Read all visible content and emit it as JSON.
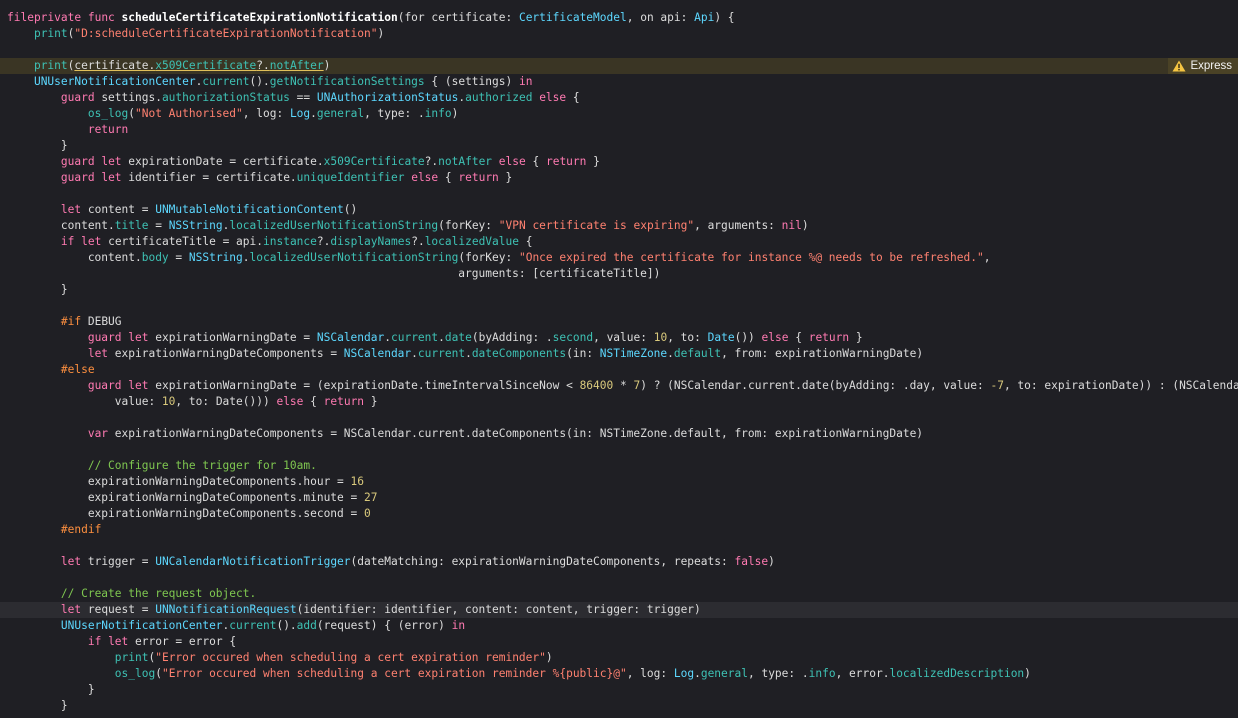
{
  "colors": {
    "background": "#1f1f24",
    "keyword": "#ff7ab2",
    "string": "#ff8170",
    "type": "#5dd8ff",
    "function": "#3ec1b4",
    "number": "#d9c97c",
    "comment": "#7fc750",
    "preprocessor": "#fd8f3f",
    "warning_line": "#3a3524",
    "warning_badge": "#4a4226"
  },
  "editor": {
    "issue_badge": {
      "icon": "warning-triangle-icon",
      "label": "Express"
    },
    "lines": [
      {
        "t": [
          [
            "kw",
            "fileprivate"
          ],
          [
            "p",
            " "
          ],
          [
            "kw",
            "func"
          ],
          [
            "p",
            " "
          ],
          [
            "b",
            "scheduleCertificateExpirationNotification"
          ],
          [
            "p",
            "(for certificate: "
          ],
          [
            "ty",
            "CertificateModel"
          ],
          [
            "p",
            ", on api: "
          ],
          [
            "ty",
            "Api"
          ],
          [
            "p",
            ") {"
          ]
        ]
      },
      {
        "t": [
          [
            "p",
            "    "
          ],
          [
            "fn",
            "print"
          ],
          [
            "p",
            "("
          ],
          [
            "s",
            "\"D:scheduleCertificateExpirationNotification\""
          ],
          [
            "p",
            ")"
          ]
        ]
      },
      {
        "t": []
      },
      {
        "hl": "warn",
        "t": [
          [
            "p",
            "    "
          ],
          [
            "fn",
            "print"
          ],
          [
            "p",
            "("
          ],
          [
            "ul",
            "certificate."
          ],
          [
            "prul",
            "x509Certificate"
          ],
          [
            "ul",
            "?."
          ],
          [
            "prul",
            "notAfter"
          ],
          [
            "p",
            ")"
          ]
        ]
      },
      {
        "t": [
          [
            "p",
            "    "
          ],
          [
            "ty",
            "UNUserNotificationCenter"
          ],
          [
            "p",
            "."
          ],
          [
            "fn",
            "current"
          ],
          [
            "p",
            "()."
          ],
          [
            "fn",
            "getNotificationSettings"
          ],
          [
            "p",
            " { (settings) "
          ],
          [
            "kw",
            "in"
          ]
        ]
      },
      {
        "t": [
          [
            "p",
            "        "
          ],
          [
            "kw",
            "guard"
          ],
          [
            "p",
            " settings."
          ],
          [
            "pr",
            "authorizationStatus"
          ],
          [
            "p",
            " == "
          ],
          [
            "ty",
            "UNAuthorizationStatus"
          ],
          [
            "p",
            "."
          ],
          [
            "pr",
            "authorized"
          ],
          [
            "p",
            " "
          ],
          [
            "kw",
            "else"
          ],
          [
            "p",
            " {"
          ]
        ]
      },
      {
        "t": [
          [
            "p",
            "            "
          ],
          [
            "fn",
            "os_log"
          ],
          [
            "p",
            "("
          ],
          [
            "s",
            "\"Not Authorised\""
          ],
          [
            "p",
            ", log: "
          ],
          [
            "ty",
            "Log"
          ],
          [
            "p",
            "."
          ],
          [
            "pr",
            "general"
          ],
          [
            "p",
            ", type: ."
          ],
          [
            "pr",
            "info"
          ],
          [
            "p",
            ")"
          ]
        ]
      },
      {
        "t": [
          [
            "p",
            "            "
          ],
          [
            "kw",
            "return"
          ]
        ]
      },
      {
        "t": [
          [
            "p",
            "        }"
          ]
        ]
      },
      {
        "t": [
          [
            "p",
            "        "
          ],
          [
            "kw",
            "guard"
          ],
          [
            "p",
            " "
          ],
          [
            "kw",
            "let"
          ],
          [
            "p",
            " expirationDate = certificate."
          ],
          [
            "pr",
            "x509Certificate"
          ],
          [
            "p",
            "?."
          ],
          [
            "pr",
            "notAfter"
          ],
          [
            "p",
            " "
          ],
          [
            "kw",
            "else"
          ],
          [
            "p",
            " { "
          ],
          [
            "kw",
            "return"
          ],
          [
            "p",
            " }"
          ]
        ]
      },
      {
        "t": [
          [
            "p",
            "        "
          ],
          [
            "kw",
            "guard"
          ],
          [
            "p",
            " "
          ],
          [
            "kw",
            "let"
          ],
          [
            "p",
            " identifier = certificate."
          ],
          [
            "pr",
            "uniqueIdentifier"
          ],
          [
            "p",
            " "
          ],
          [
            "kw",
            "else"
          ],
          [
            "p",
            " { "
          ],
          [
            "kw",
            "return"
          ],
          [
            "p",
            " }"
          ]
        ]
      },
      {
        "t": []
      },
      {
        "t": [
          [
            "p",
            "        "
          ],
          [
            "kw",
            "let"
          ],
          [
            "p",
            " content = "
          ],
          [
            "ty",
            "UNMutableNotificationContent"
          ],
          [
            "p",
            "()"
          ]
        ]
      },
      {
        "t": [
          [
            "p",
            "        content."
          ],
          [
            "pr",
            "title"
          ],
          [
            "p",
            " = "
          ],
          [
            "ty",
            "NSString"
          ],
          [
            "p",
            "."
          ],
          [
            "fn",
            "localizedUserNotificationString"
          ],
          [
            "p",
            "(forKey: "
          ],
          [
            "s",
            "\"VPN certificate is expiring\""
          ],
          [
            "p",
            ", arguments: "
          ],
          [
            "kw",
            "nil"
          ],
          [
            "p",
            ")"
          ]
        ]
      },
      {
        "t": [
          [
            "p",
            "        "
          ],
          [
            "kw",
            "if"
          ],
          [
            "p",
            " "
          ],
          [
            "kw",
            "let"
          ],
          [
            "p",
            " certificateTitle = api."
          ],
          [
            "pr",
            "instance"
          ],
          [
            "p",
            "?."
          ],
          [
            "pr",
            "displayNames"
          ],
          [
            "p",
            "?."
          ],
          [
            "pr",
            "localizedValue"
          ],
          [
            "p",
            " {"
          ]
        ]
      },
      {
        "t": [
          [
            "p",
            "            content."
          ],
          [
            "pr",
            "body"
          ],
          [
            "p",
            " = "
          ],
          [
            "ty",
            "NSString"
          ],
          [
            "p",
            "."
          ],
          [
            "fn",
            "localizedUserNotificationString"
          ],
          [
            "p",
            "(forKey: "
          ],
          [
            "s",
            "\"Once expired the certificate for instance %@ needs to be refreshed.\""
          ],
          [
            "p",
            ","
          ]
        ]
      },
      {
        "t": [
          [
            "p",
            "                                                                   arguments: [certificateTitle])"
          ]
        ]
      },
      {
        "t": [
          [
            "p",
            "        }"
          ]
        ]
      },
      {
        "t": []
      },
      {
        "t": [
          [
            "p",
            "        "
          ],
          [
            "pp",
            "#if"
          ],
          [
            "p",
            " DEBUG"
          ]
        ]
      },
      {
        "t": [
          [
            "p",
            "            "
          ],
          [
            "kw",
            "guard"
          ],
          [
            "p",
            " "
          ],
          [
            "kw",
            "let"
          ],
          [
            "p",
            " expirationWarningDate = "
          ],
          [
            "ty",
            "NSCalendar"
          ],
          [
            "p",
            "."
          ],
          [
            "pr",
            "current"
          ],
          [
            "p",
            "."
          ],
          [
            "fn",
            "date"
          ],
          [
            "p",
            "(byAdding: ."
          ],
          [
            "pr",
            "second"
          ],
          [
            "p",
            ", value: "
          ],
          [
            "n",
            "10"
          ],
          [
            "p",
            ", to: "
          ],
          [
            "ty",
            "Date"
          ],
          [
            "p",
            "()) "
          ],
          [
            "kw",
            "else"
          ],
          [
            "p",
            " { "
          ],
          [
            "kw",
            "return"
          ],
          [
            "p",
            " }"
          ]
        ]
      },
      {
        "t": [
          [
            "p",
            "            "
          ],
          [
            "kw",
            "let"
          ],
          [
            "p",
            " expirationWarningDateComponents = "
          ],
          [
            "ty",
            "NSCalendar"
          ],
          [
            "p",
            "."
          ],
          [
            "pr",
            "current"
          ],
          [
            "p",
            "."
          ],
          [
            "fn",
            "dateComponents"
          ],
          [
            "p",
            "(in: "
          ],
          [
            "ty",
            "NSTimeZone"
          ],
          [
            "p",
            "."
          ],
          [
            "pr",
            "default"
          ],
          [
            "p",
            ", from: expirationWarningDate)"
          ]
        ]
      },
      {
        "t": [
          [
            "p",
            "        "
          ],
          [
            "pp",
            "#else"
          ]
        ]
      },
      {
        "t": [
          [
            "p",
            "            "
          ],
          [
            "kw",
            "guard"
          ],
          [
            "p",
            " "
          ],
          [
            "kw",
            "let"
          ],
          [
            "p",
            " expirationWarningDate = (expirationDate.timeIntervalSinceNow < "
          ],
          [
            "n",
            "86400"
          ],
          [
            "p",
            " * "
          ],
          [
            "n",
            "7"
          ],
          [
            "p",
            ") ? (NSCalendar.current.date(byAdding: .day, value: "
          ],
          [
            "n",
            "-7"
          ],
          [
            "p",
            ", to: expirationDate)) : (NSCalendar.current.date(byAdding: .second,"
          ]
        ]
      },
      {
        "t": [
          [
            "p",
            "                value: "
          ],
          [
            "n",
            "10"
          ],
          [
            "p",
            ", to: Date())) "
          ],
          [
            "kw",
            "else"
          ],
          [
            "p",
            " { "
          ],
          [
            "kw",
            "return"
          ],
          [
            "p",
            " }"
          ]
        ]
      },
      {
        "t": []
      },
      {
        "t": [
          [
            "p",
            "            "
          ],
          [
            "kw",
            "var"
          ],
          [
            "p",
            " expirationWarningDateComponents = NSCalendar.current.dateComponents(in: NSTimeZone.default, from: expirationWarningDate)"
          ]
        ]
      },
      {
        "t": []
      },
      {
        "t": [
          [
            "p",
            "            "
          ],
          [
            "c",
            "// Configure the trigger for 10am."
          ]
        ]
      },
      {
        "t": [
          [
            "p",
            "            expirationWarningDateComponents.hour = "
          ],
          [
            "n",
            "16"
          ]
        ]
      },
      {
        "t": [
          [
            "p",
            "            expirationWarningDateComponents.minute = "
          ],
          [
            "n",
            "27"
          ]
        ]
      },
      {
        "t": [
          [
            "p",
            "            expirationWarningDateComponents.second = "
          ],
          [
            "n",
            "0"
          ]
        ]
      },
      {
        "t": [
          [
            "p",
            "        "
          ],
          [
            "pp",
            "#endif"
          ]
        ]
      },
      {
        "t": []
      },
      {
        "t": [
          [
            "p",
            "        "
          ],
          [
            "kw",
            "let"
          ],
          [
            "p",
            " trigger = "
          ],
          [
            "ty",
            "UNCalendarNotificationTrigger"
          ],
          [
            "p",
            "(dateMatching: expirationWarningDateComponents, repeats: "
          ],
          [
            "kw",
            "false"
          ],
          [
            "p",
            ")"
          ]
        ]
      },
      {
        "t": []
      },
      {
        "t": [
          [
            "p",
            "        "
          ],
          [
            "c",
            "// Create the request object."
          ]
        ]
      },
      {
        "hl": "current",
        "t": [
          [
            "p",
            "        "
          ],
          [
            "kw",
            "let"
          ],
          [
            "p",
            " request = "
          ],
          [
            "ty",
            "UNNotificationRequest"
          ],
          [
            "p",
            "(identifier: identifier, content: content, trigger: trigger)"
          ]
        ]
      },
      {
        "t": [
          [
            "p",
            "        "
          ],
          [
            "ty",
            "UNUserNotificationCenter"
          ],
          [
            "p",
            "."
          ],
          [
            "fn",
            "current"
          ],
          [
            "p",
            "()."
          ],
          [
            "fn",
            "add"
          ],
          [
            "p",
            "(request) { (error) "
          ],
          [
            "kw",
            "in"
          ]
        ]
      },
      {
        "t": [
          [
            "p",
            "            "
          ],
          [
            "kw",
            "if"
          ],
          [
            "p",
            " "
          ],
          [
            "kw",
            "let"
          ],
          [
            "p",
            " error = error {"
          ]
        ]
      },
      {
        "t": [
          [
            "p",
            "                "
          ],
          [
            "fn",
            "print"
          ],
          [
            "p",
            "("
          ],
          [
            "s",
            "\"Error occured when scheduling a cert expiration reminder\""
          ],
          [
            "p",
            ")"
          ]
        ]
      },
      {
        "t": [
          [
            "p",
            "                "
          ],
          [
            "fn",
            "os_log"
          ],
          [
            "p",
            "("
          ],
          [
            "s",
            "\"Error occured when scheduling a cert expiration reminder %{public}@\""
          ],
          [
            "p",
            ", log: "
          ],
          [
            "ty",
            "Log"
          ],
          [
            "p",
            "."
          ],
          [
            "pr",
            "general"
          ],
          [
            "p",
            ", type: ."
          ],
          [
            "pr",
            "info"
          ],
          [
            "p",
            ", error."
          ],
          [
            "pr",
            "localizedDescription"
          ],
          [
            "p",
            ")"
          ]
        ]
      },
      {
        "t": [
          [
            "p",
            "            }"
          ]
        ]
      },
      {
        "t": [
          [
            "p",
            "        }"
          ]
        ]
      }
    ]
  }
}
